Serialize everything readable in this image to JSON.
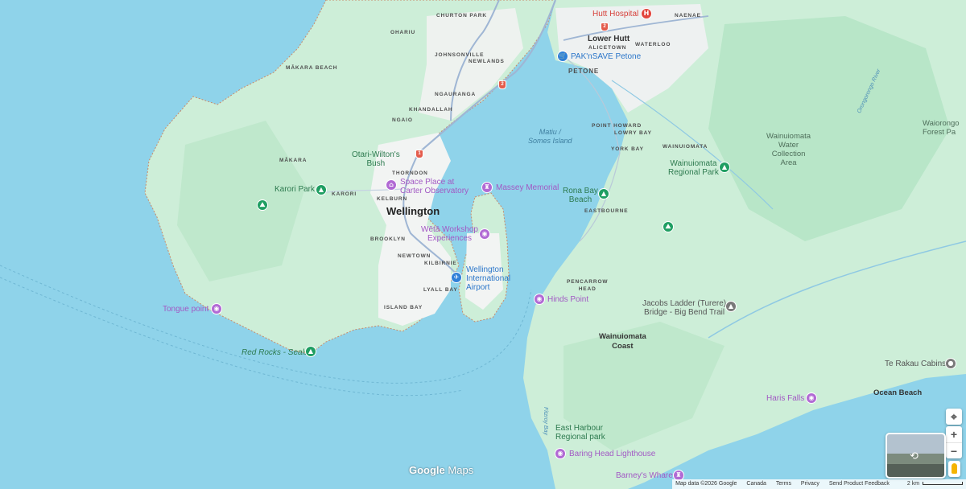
{
  "map": {
    "suburbs": [
      {
        "id": "churton-park",
        "label": "CHURTON PARK"
      },
      {
        "id": "ohariu",
        "label": "OHARIU"
      },
      {
        "id": "johnsonville",
        "label": "JOHNSONVILLE"
      },
      {
        "id": "newlands",
        "label": "NEWLANDS"
      },
      {
        "id": "makara-beach",
        "label": "MĀKARA BEACH"
      },
      {
        "id": "ngauranga",
        "label": "NGAURANGA"
      },
      {
        "id": "khandallah",
        "label": "KHANDALLAH"
      },
      {
        "id": "ngaio",
        "label": "NGAIO"
      },
      {
        "id": "makara",
        "label": "MĀKARA"
      },
      {
        "id": "thorndon",
        "label": "THORNDON"
      },
      {
        "id": "karori",
        "label": "KARORI"
      },
      {
        "id": "kelburn",
        "label": "KELBURN"
      },
      {
        "id": "brooklyn",
        "label": "BROOKLYN"
      },
      {
        "id": "newtown",
        "label": "NEWTOWN"
      },
      {
        "id": "kilbirnie",
        "label": "KILBIRNIE"
      },
      {
        "id": "lyall-bay",
        "label": "LYALL BAY"
      },
      {
        "id": "island-bay",
        "label": "ISLAND BAY"
      },
      {
        "id": "alicetown",
        "label": "ALICETOWN"
      },
      {
        "id": "waterloo",
        "label": "WATERLOO"
      },
      {
        "id": "naenae",
        "label": "NAENAE"
      },
      {
        "id": "petone",
        "label": "PETONE"
      },
      {
        "id": "point-howard",
        "label": "POINT HOWARD"
      },
      {
        "id": "lowry-bay",
        "label": "LOWRY BAY"
      },
      {
        "id": "york-bay",
        "label": "YORK BAY"
      },
      {
        "id": "wainuiomata-sub",
        "label": "WAINUIOMATA"
      },
      {
        "id": "eastbourne",
        "label": "EASTBOURNE"
      },
      {
        "id": "pencarrow-head",
        "label": "PENCARROW\nHEAD"
      }
    ],
    "cities": [
      {
        "id": "wellington",
        "label": "Wellington"
      },
      {
        "id": "lower-hutt",
        "label": "Lower Hutt"
      },
      {
        "id": "wainuiomata-coast",
        "label": "Wainuiomata\nCoast"
      },
      {
        "id": "ocean-beach",
        "label": "Ocean Beach"
      }
    ],
    "water_labels": [
      {
        "id": "matiu",
        "label": "Matiu /\nSomes Island"
      },
      {
        "id": "fitzroy-bay",
        "label": "Fitzroy Bay"
      },
      {
        "id": "orongorongo-river",
        "label": "Orongorongo River"
      }
    ],
    "areas": [
      {
        "id": "wainuiomata-water",
        "label": "Wainuiomata\nWater\nCollection\nArea"
      },
      {
        "id": "waiorongo",
        "label": "Waiorongo\nForest Pa"
      }
    ],
    "pois": [
      {
        "id": "hutt-hospital",
        "label": "Hutt Hospital",
        "kind": "r",
        "icon": "H"
      },
      {
        "id": "paknsave",
        "label": "PAK'nSAVE Petone",
        "kind": "b",
        "icon": "🛒"
      },
      {
        "id": "otari",
        "label": "Otari-Wilton's\nBush",
        "kind": "g",
        "icon": ""
      },
      {
        "id": "space-place",
        "label": "Space Place at\nCarter Observatory",
        "kind": "p",
        "icon": "⌂"
      },
      {
        "id": "massey",
        "label": "Massey Memorial",
        "kind": "p",
        "icon": "♜"
      },
      {
        "id": "karori-park",
        "label": "Karori Park",
        "kind": "g",
        "icon": "▲"
      },
      {
        "id": "weta",
        "label": "Wētā Workshop\nExperiences",
        "kind": "p",
        "icon": "◉"
      },
      {
        "id": "rona-bay",
        "label": "Rona Bay\nBeach",
        "kind": "g",
        "icon": "▲"
      },
      {
        "id": "wainuiomata-park",
        "label": "Wainuiomata\nRegional Park",
        "kind": "g",
        "icon": "▲"
      },
      {
        "id": "airport",
        "label": "Wellington\nInternational\nAirport",
        "kind": "b",
        "icon": "✈"
      },
      {
        "id": "tongue-point",
        "label": "Tongue point",
        "kind": "p",
        "icon": "◉"
      },
      {
        "id": "hinds-point",
        "label": "Hinds Point",
        "kind": "p",
        "icon": "◉"
      },
      {
        "id": "jacobs-ladder",
        "label": "Jacobs Ladder (Turere)\nBridge - Big Bend Trail",
        "kind": "gray",
        "icon": "▲"
      },
      {
        "id": "red-rocks",
        "label": "Red Rocks - Seals",
        "kind": "g",
        "icon": "▲"
      },
      {
        "id": "te-rakau",
        "label": "Te Rakau Cabins",
        "kind": "gray",
        "icon": "●"
      },
      {
        "id": "haris-falls",
        "label": "Haris Falls",
        "kind": "p",
        "icon": "◉"
      },
      {
        "id": "east-harbour",
        "label": "East Harbour\nRegional park",
        "kind": "g",
        "icon": ""
      },
      {
        "id": "baring-head",
        "label": "Baring Head Lighthouse",
        "kind": "p",
        "icon": "◉"
      },
      {
        "id": "barneys-whare",
        "label": "Barney's Whare",
        "kind": "p",
        "icon": "♜"
      }
    ],
    "highway_shields": [
      {
        "id": "sh-1",
        "label": "1"
      },
      {
        "id": "sh-2a",
        "label": "2"
      },
      {
        "id": "sh-2b",
        "label": "2"
      }
    ],
    "colors": {
      "water": "#8fd3ea",
      "land": "#cdeed8",
      "park": "#b8e6c8",
      "urban": "#f2f4f3",
      "road": "#9fb6d4",
      "border": "#c98a6a"
    }
  },
  "branding": {
    "google": "Google",
    "maps": "Maps"
  },
  "footer": {
    "map_data": "Map data ©2026 Google",
    "country": "Canada",
    "terms": "Terms",
    "privacy": "Privacy",
    "feedback": "Send Product Feedback",
    "scale": "2 km"
  },
  "controls": {
    "zoom_in": "+",
    "zoom_out": "−",
    "location_icon": "⌖"
  }
}
